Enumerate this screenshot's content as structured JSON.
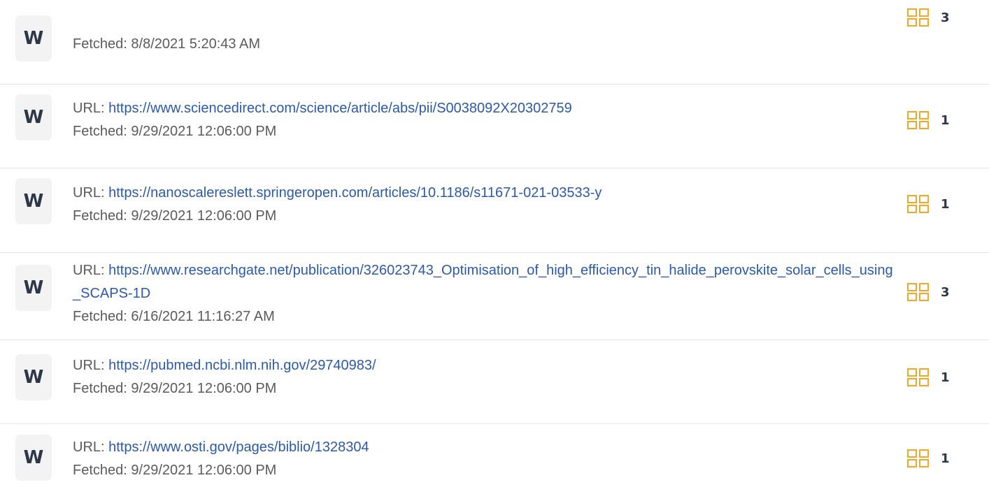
{
  "labels": {
    "url_prefix": "URL: ",
    "fetched_prefix": "Fetched: "
  },
  "accent_color": "#f5a623",
  "icons": {
    "source": "w-letter-icon",
    "matches": "grid-icon"
  },
  "results": [
    {
      "badge": "W",
      "url": null,
      "fetched": "8/8/2021 5:20:43 AM",
      "match_count": "3"
    },
    {
      "badge": "W",
      "url": "https://www.sciencedirect.com/science/article/abs/pii/S0038092X20302759",
      "fetched": "9/29/2021 12:06:00 PM",
      "match_count": "1"
    },
    {
      "badge": "W",
      "url": "https://nanoscalereslett.springeropen.com/articles/10.1186/s11671-021-03533-y",
      "fetched": "9/29/2021 12:06:00 PM",
      "match_count": "1"
    },
    {
      "badge": "W",
      "url": "https://www.researchgate.net/publication/326023743_Optimisation_of_high_efficiency_tin_halide_perovskite_solar_cells_using_SCAPS-1D",
      "fetched": "6/16/2021 11:16:27 AM",
      "match_count": "3"
    },
    {
      "badge": "W",
      "url": "https://pubmed.ncbi.nlm.nih.gov/29740983/",
      "fetched": "9/29/2021 12:06:00 PM",
      "match_count": "1"
    },
    {
      "badge": "W",
      "url": "https://www.osti.gov/pages/biblio/1328304",
      "fetched": "9/29/2021 12:06:00 PM",
      "match_count": "1"
    }
  ]
}
